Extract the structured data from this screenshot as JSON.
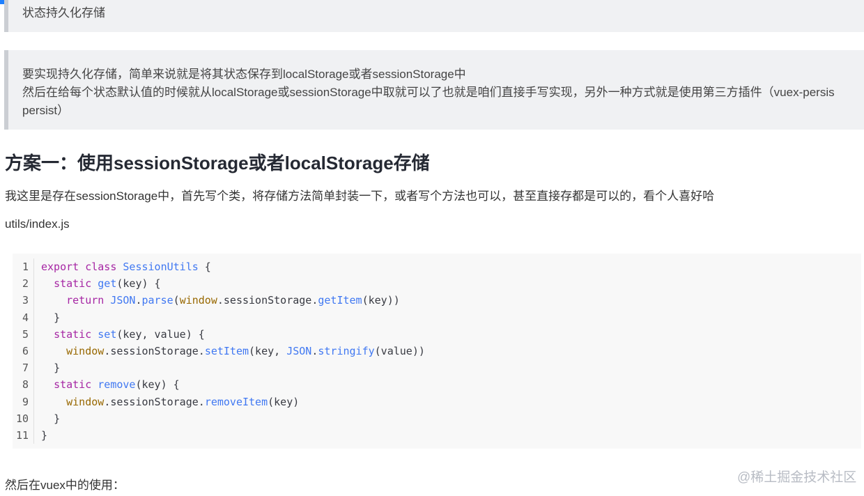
{
  "quote_1": {
    "text": "状态持久化存储"
  },
  "quote_2": {
    "line_1": "要实现持久化存储，简单来说就是将其状态保存到localStorage或者sessionStorage中",
    "line_2": "然后在给每个状态默认值的时候就从localStorage或sessionStorage中取就可以了也就是咱们直接手写实现，另外一种方式就是使用第三方插件（vuex-persis",
    "line_3": "persist）"
  },
  "heading": "方案一：使用sessionStorage或者localStorage存储",
  "paragraph_1": "我这里是存在sessionStorage中，首先写个类，将存储方法简单封装一下，或者写个方法也可以，甚至直接存都是可以的，看个人喜好哈",
  "paragraph_2": "utils/index.js",
  "code": {
    "line_numbers": [
      "1",
      "2",
      "3",
      "4",
      "5",
      "6",
      "7",
      "8",
      "9",
      "10",
      "11"
    ],
    "tokens": {
      "l1_export": "export",
      "l1_class": "class",
      "l1_name": "SessionUtils",
      "l1_rest": " {",
      "l2_static": "static",
      "l2_fn": "get",
      "l2_rest": "(key) {",
      "l3_return": "return",
      "l3_json": "JSON",
      "l3_parse": "parse",
      "l3_window": "window",
      "l3_session": ".sessionStorage.",
      "l3_getitem": "getItem",
      "l3_rest": "(key))",
      "l4": "}",
      "l5_static": "static",
      "l5_fn": "set",
      "l5_rest": "(key, value) {",
      "l6_window": "window",
      "l6_session": ".sessionStorage.",
      "l6_setitem": "setItem",
      "l6_mid": "(key, ",
      "l6_json": "JSON",
      "l6_stringify": "stringify",
      "l6_rest": "(value))",
      "l7": "}",
      "l8_static": "static",
      "l8_fn": "remove",
      "l8_rest": "(key) {",
      "l9_window": "window",
      "l9_session": ".sessionStorage.",
      "l9_removeitem": "removeItem",
      "l9_rest": "(key)",
      "l10": "}",
      "l11": "}"
    }
  },
  "paragraph_3": "然后在vuex中的使用：",
  "watermark": "@稀土掘金技术社区",
  "colors": {
    "accent_bar": "#1e80ff",
    "keyword": "#a626a4",
    "function": "#4078f2",
    "builtin": "#986801",
    "quote_background": "#f0f1f3"
  }
}
